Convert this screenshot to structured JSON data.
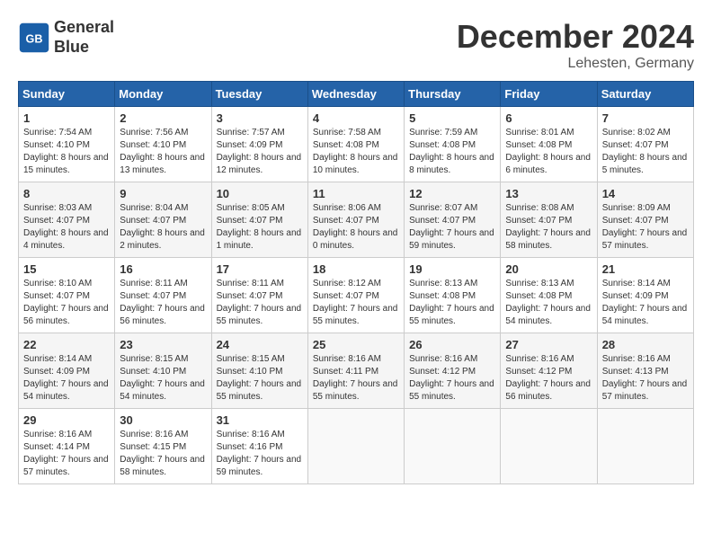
{
  "header": {
    "logo_line1": "General",
    "logo_line2": "Blue",
    "month": "December 2024",
    "location": "Lehesten, Germany"
  },
  "days_of_week": [
    "Sunday",
    "Monday",
    "Tuesday",
    "Wednesday",
    "Thursday",
    "Friday",
    "Saturday"
  ],
  "weeks": [
    [
      {
        "day": "1",
        "sunrise": "7:54 AM",
        "sunset": "4:10 PM",
        "daylight": "8 hours and 15 minutes."
      },
      {
        "day": "2",
        "sunrise": "7:56 AM",
        "sunset": "4:10 PM",
        "daylight": "8 hours and 13 minutes."
      },
      {
        "day": "3",
        "sunrise": "7:57 AM",
        "sunset": "4:09 PM",
        "daylight": "8 hours and 12 minutes."
      },
      {
        "day": "4",
        "sunrise": "7:58 AM",
        "sunset": "4:08 PM",
        "daylight": "8 hours and 10 minutes."
      },
      {
        "day": "5",
        "sunrise": "7:59 AM",
        "sunset": "4:08 PM",
        "daylight": "8 hours and 8 minutes."
      },
      {
        "day": "6",
        "sunrise": "8:01 AM",
        "sunset": "4:08 PM",
        "daylight": "8 hours and 6 minutes."
      },
      {
        "day": "7",
        "sunrise": "8:02 AM",
        "sunset": "4:07 PM",
        "daylight": "8 hours and 5 minutes."
      }
    ],
    [
      {
        "day": "8",
        "sunrise": "8:03 AM",
        "sunset": "4:07 PM",
        "daylight": "8 hours and 4 minutes."
      },
      {
        "day": "9",
        "sunrise": "8:04 AM",
        "sunset": "4:07 PM",
        "daylight": "8 hours and 2 minutes."
      },
      {
        "day": "10",
        "sunrise": "8:05 AM",
        "sunset": "4:07 PM",
        "daylight": "8 hours and 1 minute."
      },
      {
        "day": "11",
        "sunrise": "8:06 AM",
        "sunset": "4:07 PM",
        "daylight": "8 hours and 0 minutes."
      },
      {
        "day": "12",
        "sunrise": "8:07 AM",
        "sunset": "4:07 PM",
        "daylight": "7 hours and 59 minutes."
      },
      {
        "day": "13",
        "sunrise": "8:08 AM",
        "sunset": "4:07 PM",
        "daylight": "7 hours and 58 minutes."
      },
      {
        "day": "14",
        "sunrise": "8:09 AM",
        "sunset": "4:07 PM",
        "daylight": "7 hours and 57 minutes."
      }
    ],
    [
      {
        "day": "15",
        "sunrise": "8:10 AM",
        "sunset": "4:07 PM",
        "daylight": "7 hours and 56 minutes."
      },
      {
        "day": "16",
        "sunrise": "8:11 AM",
        "sunset": "4:07 PM",
        "daylight": "7 hours and 56 minutes."
      },
      {
        "day": "17",
        "sunrise": "8:11 AM",
        "sunset": "4:07 PM",
        "daylight": "7 hours and 55 minutes."
      },
      {
        "day": "18",
        "sunrise": "8:12 AM",
        "sunset": "4:07 PM",
        "daylight": "7 hours and 55 minutes."
      },
      {
        "day": "19",
        "sunrise": "8:13 AM",
        "sunset": "4:08 PM",
        "daylight": "7 hours and 55 minutes."
      },
      {
        "day": "20",
        "sunrise": "8:13 AM",
        "sunset": "4:08 PM",
        "daylight": "7 hours and 54 minutes."
      },
      {
        "day": "21",
        "sunrise": "8:14 AM",
        "sunset": "4:09 PM",
        "daylight": "7 hours and 54 minutes."
      }
    ],
    [
      {
        "day": "22",
        "sunrise": "8:14 AM",
        "sunset": "4:09 PM",
        "daylight": "7 hours and 54 minutes."
      },
      {
        "day": "23",
        "sunrise": "8:15 AM",
        "sunset": "4:10 PM",
        "daylight": "7 hours and 54 minutes."
      },
      {
        "day": "24",
        "sunrise": "8:15 AM",
        "sunset": "4:10 PM",
        "daylight": "7 hours and 55 minutes."
      },
      {
        "day": "25",
        "sunrise": "8:16 AM",
        "sunset": "4:11 PM",
        "daylight": "7 hours and 55 minutes."
      },
      {
        "day": "26",
        "sunrise": "8:16 AM",
        "sunset": "4:12 PM",
        "daylight": "7 hours and 55 minutes."
      },
      {
        "day": "27",
        "sunrise": "8:16 AM",
        "sunset": "4:12 PM",
        "daylight": "7 hours and 56 minutes."
      },
      {
        "day": "28",
        "sunrise": "8:16 AM",
        "sunset": "4:13 PM",
        "daylight": "7 hours and 57 minutes."
      }
    ],
    [
      {
        "day": "29",
        "sunrise": "8:16 AM",
        "sunset": "4:14 PM",
        "daylight": "7 hours and 57 minutes."
      },
      {
        "day": "30",
        "sunrise": "8:16 AM",
        "sunset": "4:15 PM",
        "daylight": "7 hours and 58 minutes."
      },
      {
        "day": "31",
        "sunrise": "8:16 AM",
        "sunset": "4:16 PM",
        "daylight": "7 hours and 59 minutes."
      },
      null,
      null,
      null,
      null
    ]
  ]
}
